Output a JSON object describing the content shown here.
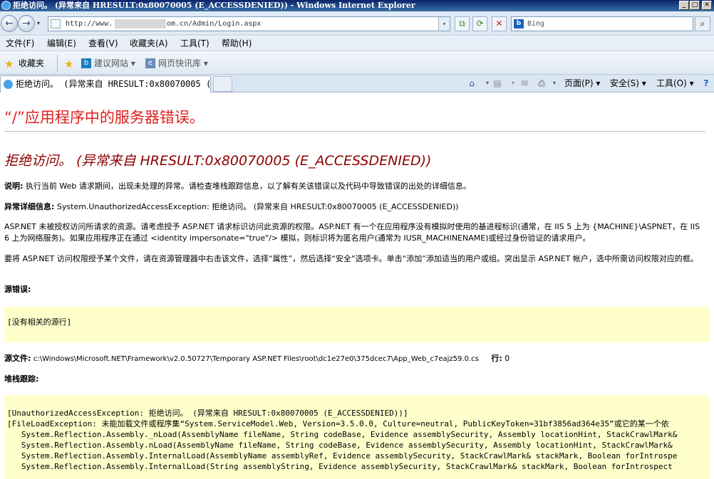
{
  "window": {
    "title": "拒绝访问。 (异常来自 HRESULT:0x80070005 (E_ACCESSDENIED)) - Windows Internet Explorer"
  },
  "address": {
    "url_prefix": "http://www.",
    "url_suffix": "om.cn/Admin/Login.aspx",
    "search_placeholder": "Bing",
    "search_icon": "bing-icon"
  },
  "menu": {
    "items": [
      "文件(F)",
      "编辑(E)",
      "查看(V)",
      "收藏夹(A)",
      "工具(T)",
      "帮助(H)"
    ]
  },
  "favorites": {
    "label": "收藏夹",
    "items": [
      "建议网站 ▾",
      "网页快讯库 ▾"
    ]
  },
  "tab": {
    "title": "拒绝访问。 (异常来自 HRESULT:0x80070005 (..."
  },
  "commands": {
    "page": "页面(P) ▾",
    "safety": "安全(S) ▾",
    "tools": "工具(O) ▾"
  },
  "page": {
    "heading": "“/”应用程序中的服务器错误。",
    "error_title": "拒绝访问。 (异常来自 HRESULT:0x80070005 (E_ACCESSDENIED))",
    "description_label": "说明:",
    "description_text": "执行当前 Web 请求期间，出现未处理的异常。请检查堆栈跟踪信息，以了解有关该错误以及代码中导致错误的出处的详细信息。",
    "exception_label": "异常详细信息:",
    "exception_text": "System.UnauthorizedAccessException: 拒绝访问。 (异常来自 HRESULT:0x80070005 (E_ACCESSDENIED))",
    "aspnet_para": "ASP.NET 未被授权访问所请求的资源。请考虑授予 ASP.NET 请求标识访问此资源的权限。ASP.NET 有一个在应用程序没有模拟时使用的基进程标识(通常，在 IIS 5 上为 {MACHINE}\\ASPNET，在 IIS 6 上为网络服务)。如果应用程序正在通过 <identity impersonate=\"true\"/> 模拟，则标识将为匿名用户(通常为 IUSR_MACHINENAME)或经过身份验证的请求用户。",
    "grant_para": "要将 ASP.NET 访问权限授予某个文件，请在资源管理器中右击该文件，选择“属性”，然后选择“安全”选项卡。单击“添加”添加适当的用户或组。突出显示 ASP.NET 帐户，选中所需访问权限对应的框。",
    "source_error_label": "源错误:",
    "source_error_text": "[没有相关的源行]",
    "source_file_label": "源文件:",
    "source_file_text": "c:\\Windows\\Microsoft.NET\\Framework\\v2.0.50727\\Temporary ASP.NET Files\\root\\dc1e27e0\\375dcec7\\App_Web_c7eajz59.0.cs",
    "line_label": "行:",
    "line_value": "0",
    "stack_label": "堆栈跟踪:",
    "stack_lines": [
      "[UnauthorizedAccessException: 拒绝访问。 (异常来自 HRESULT:0x80070005 (E_ACCESSDENIED))]",
      "",
      "[FileLoadException: 未能加载文件或程序集“System.ServiceModel.Web, Version=3.5.0.0, Culture=neutral, PublicKeyToken=31bf3856ad364e35”或它的某一个依",
      "   System.Reflection.Assembly._nLoad(AssemblyName fileName, String codeBase, Evidence assemblySecurity, Assembly locationHint, StackCrawlMark&",
      "   System.Reflection.Assembly.nLoad(AssemblyName fileName, String codeBase, Evidence assemblySecurity, Assembly locationHint, StackCrawlMark&",
      "   System.Reflection.Assembly.InternalLoad(AssemblyName assemblyRef, Evidence assemblySecurity, StackCrawlMark& stackMark, Boolean forIntrospe",
      "   System.Reflection.Assembly.InternalLoad(String assemblyString, Evidence assemblySecurity, StackCrawlMark& stackMark, Boolean forIntrospect"
    ]
  }
}
